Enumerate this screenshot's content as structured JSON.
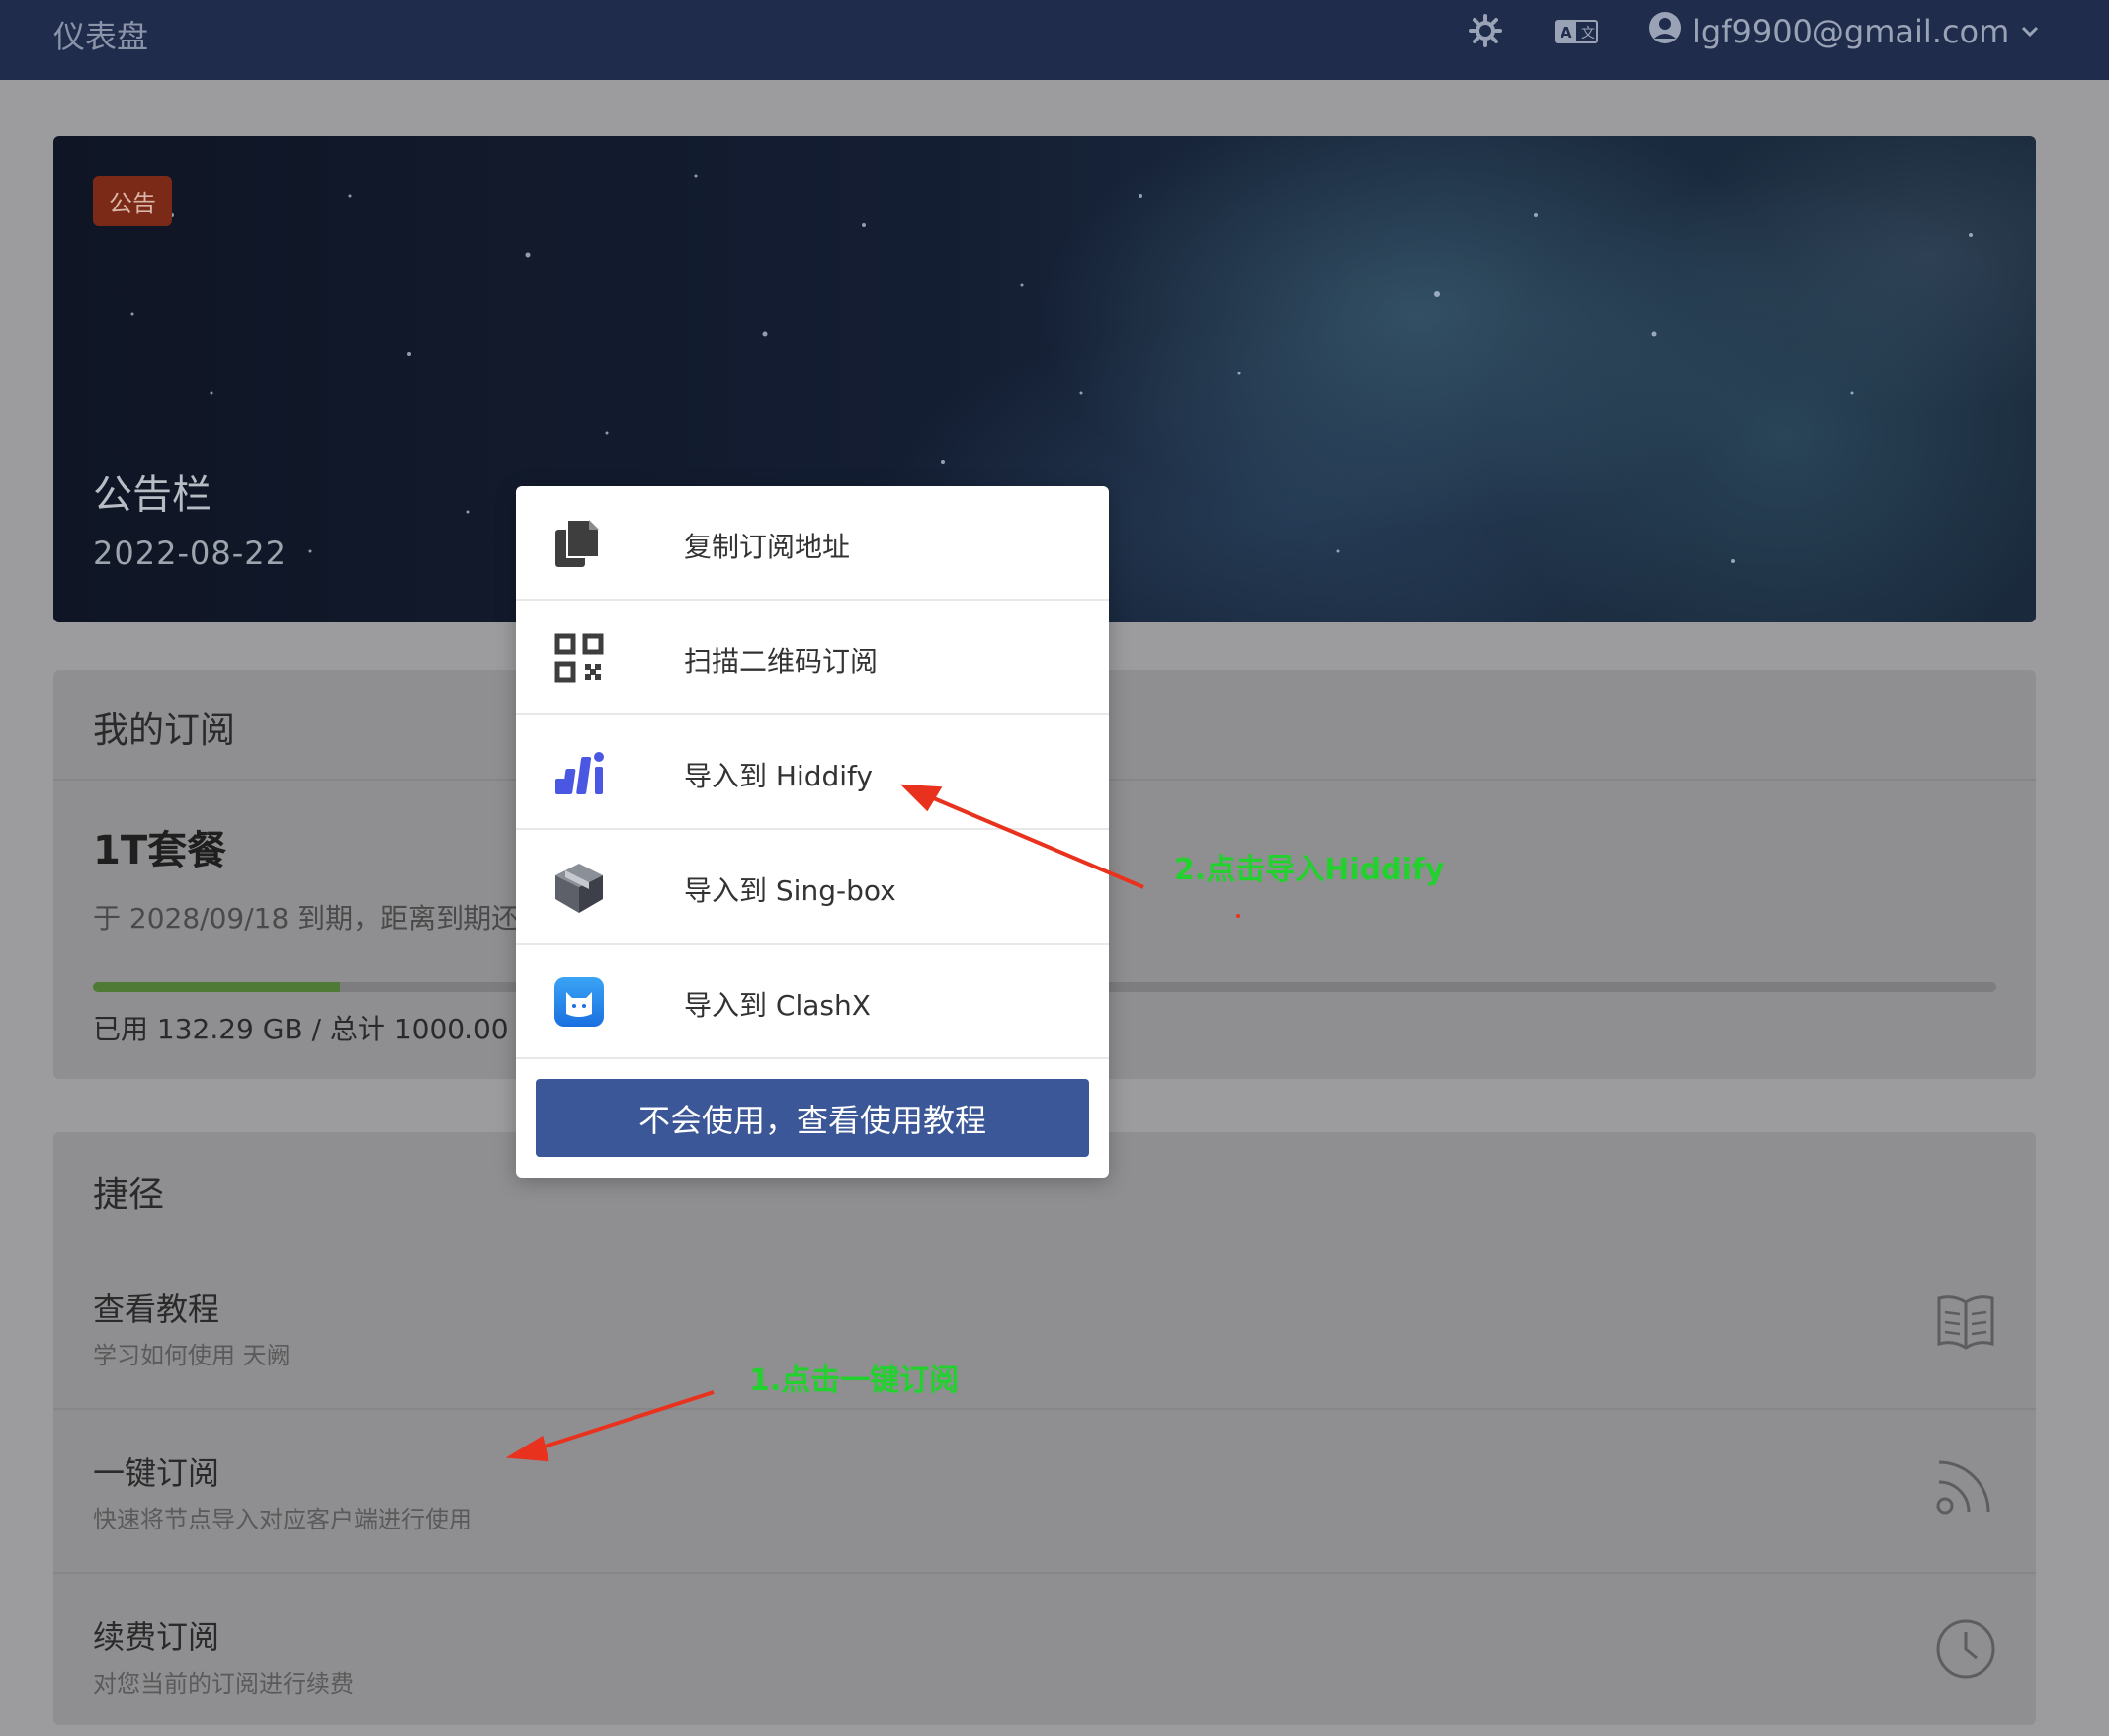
{
  "header": {
    "title": "仪表盘",
    "user_email": "lgf9900@gmail.com",
    "icons": [
      "theme-toggle-icon",
      "translate-icon",
      "user-avatar-icon",
      "chevron-down-icon"
    ]
  },
  "notice": {
    "badge": "公告",
    "title": "公告栏",
    "date": "2022-08-22"
  },
  "subscription": {
    "heading": "我的订阅",
    "plan_name": "1T套餐",
    "expiry_text": "于 2028/09/18 到期，距离到期还",
    "usage_text": "已用 132.29 GB / 总计 1000.00",
    "usage_fraction": 0.13
  },
  "shortcuts": {
    "heading": "捷径",
    "items": [
      {
        "title": "查看教程",
        "subtitle": "学习如何使用 天阙",
        "icon": "book-icon"
      },
      {
        "title": "一键订阅",
        "subtitle": "快速将节点导入对应客户端进行使用",
        "icon": "rss-icon"
      },
      {
        "title": "续费订阅",
        "subtitle": "对您当前的订阅进行续费",
        "icon": "clock-icon"
      }
    ]
  },
  "popup": {
    "items": [
      {
        "label": "复制订阅地址",
        "icon": "copy-icon"
      },
      {
        "label": "扫描二维码订阅",
        "icon": "qrcode-icon"
      },
      {
        "label": "导入到 Hiddify",
        "icon": "hiddify-icon"
      },
      {
        "label": "导入到 Sing-box",
        "icon": "singbox-icon"
      },
      {
        "label": "导入到 ClashX",
        "icon": "clashx-icon"
      }
    ],
    "tutorial_button": "不会使用，查看使用教程"
  },
  "annotations": {
    "step1": "1.点击一键订阅",
    "step2": "2.点击导入Hiddify"
  },
  "colors": {
    "topbar": "#1f2c4c",
    "badge": "#7a2a17",
    "primary_button": "#3b5797",
    "annotation_text": "#22d12e",
    "annotation_arrow": "#e8321e",
    "progress": "#4f7a35"
  }
}
